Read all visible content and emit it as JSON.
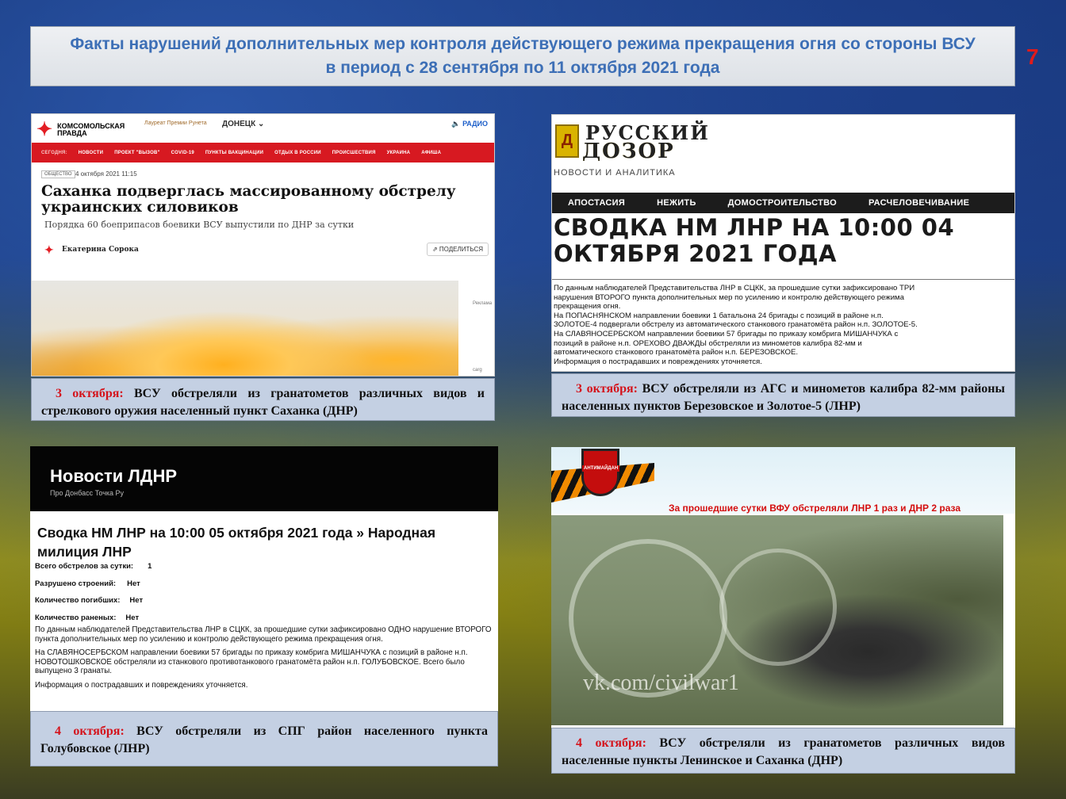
{
  "title": {
    "line1": "Факты нарушений дополнительных мер контроля действующего режима прекращения огня со стороны ВСУ",
    "line2": "в период с 28 сентября по 11 октября 2021 года"
  },
  "slide_number": "7",
  "panel1": {
    "site_name": "КОМСОМОЛЬСКАЯ ПРАВДА",
    "laureat": "Лауреат Премии Рунета",
    "region": "ДОНЕЦК ⌄",
    "radio": "🔈 РАДИО",
    "nav": [
      "СЕГОДНЯ:",
      "НОВОСТИ",
      "ПРОЕКТ \"ВЫЗОВ\"",
      "COVID-19",
      "ПУНКТЫ ВАКЦИНАЦИИ",
      "ОТДЫХ В РОССИИ",
      "ПРОИСШЕСТВИЯ",
      "УКРАИНА",
      "АФИША"
    ],
    "tag": "ОБЩЕСТВО",
    "date": "4 октября 2021 11:15",
    "headline": "Саханка подверглась массированному обстрелу украинских силовиков",
    "subtitle": "Порядка 60 боеприпасов боевики ВСУ выпустили по ДНР за сутки",
    "author": "Екатерина Сорока",
    "share": "⇗ ПОДЕЛИТЬСЯ",
    "side1": "Реклама",
    "side2": "carg"
  },
  "caption1": {
    "date": "3 октября:",
    "text": " ВСУ обстреляли из гранатометов различных видов и стрелкового оружия населенный пункт Саханка (ДНР)"
  },
  "panel2": {
    "brand1": "РУССКИЙ",
    "brand2": "ДОЗОР",
    "tagline": "НОВОСТИ И АНАЛИТИКА",
    "nav": [
      "АПОСТАСИЯ",
      "НЕЖИТЬ",
      "ДОМОСТРОИТЕЛЬСТВО",
      "РАСЧЕЛОВЕЧИВАНИЕ"
    ],
    "headline1": "СВОДКА НМ ЛНР НА 10:00 04",
    "headline2": "ОКТЯБРЯ 2021 ГОДА",
    "body": [
      "По данным наблюдателей Представительства ЛНР в СЦКК, за прошедшие сутки зафиксировано ТРИ",
      "нарушения ВТОРОГО пункта дополнительных мер по усилению и контролю действующего режима",
      "прекращения огня.",
      "На ПОПАСНЯНСКОМ направлении боевики 1 батальона 24 бригады с позиций в районе н.п.",
      "ЗОЛОТОЕ-4 подвергали обстрелу из автоматического станкового гранатомёта район н.п. ЗОЛОТОЕ-5.",
      "На СЛАВЯНОСЕРБСКОМ направлении боевики 57 бригады по приказу комбрига МИШАНЧУКА с",
      "позиций в районе н.п. ОРЕХОВО ДВАЖДЫ обстреляли из минометов калибра 82-мм и",
      "автоматического станкового гранатомёта район н.п. БЕРЕЗОВСКОЕ.",
      "Информация о пострадавших и повреждениях уточняется."
    ]
  },
  "caption2": {
    "date": "3 октября:",
    "text": " ВСУ обстреляли из АГС и минометов калибра 82-мм районы населенных пунктов Березовское и Золотое-5 (ЛНР)"
  },
  "panel3": {
    "site": "Новости ЛДНР",
    "site_sub": "Про Донбасс Точка Ру",
    "headline": "Сводка НМ ЛНР на 10:00 05 октября 2021 года » Народная милиция ЛНР",
    "stats": [
      {
        "label": "Всего обстрелов за сутки:",
        "value": "1"
      },
      {
        "label": "Разрушено строений:",
        "value": "Нет"
      },
      {
        "label": "Количество погибших:",
        "value": "Нет"
      },
      {
        "label": "Количество раненых:",
        "value": "Нет"
      }
    ],
    "para1": "По данным наблюдателей Представительства ЛНР в СЦКК, за прошедшие сутки зафиксировано ОДНО нарушение ВТОРОГО пункта дополнительных мер по усилению и контролю действующего режима прекращения огня.",
    "para2": "На СЛАВЯНОСЕРБСКОМ направлении боевики 57 бригады по приказу комбрига МИШАНЧУКА с позиций в районе н.п. НОВОТОШКОВСКОЕ обстреляли из станкового противотанкового гранатомёта район н.п. ГОЛУБОВСКОЕ. Всего было выпущено 3 гранаты.",
    "para3": "Информация о пострадавших и повреждениях уточняется."
  },
  "caption3": {
    "date": "4 октября:",
    "text": " ВСУ обстреляли из СПГ район населенного пункта Голубовское (ЛНР)"
  },
  "panel4": {
    "badge": "АНТИМАЙДАН",
    "red_text": "За прошедшие сутки ВФУ обстреляли ЛНР 1 раз и ДНР 2 раза",
    "watermark": "vk.com/civilwar1"
  },
  "caption4": {
    "date": "4 октября:",
    "text": " ВСУ обстреляли из гранатометов различных видов населенные пункты Ленинское и Саханка (ДНР)"
  }
}
